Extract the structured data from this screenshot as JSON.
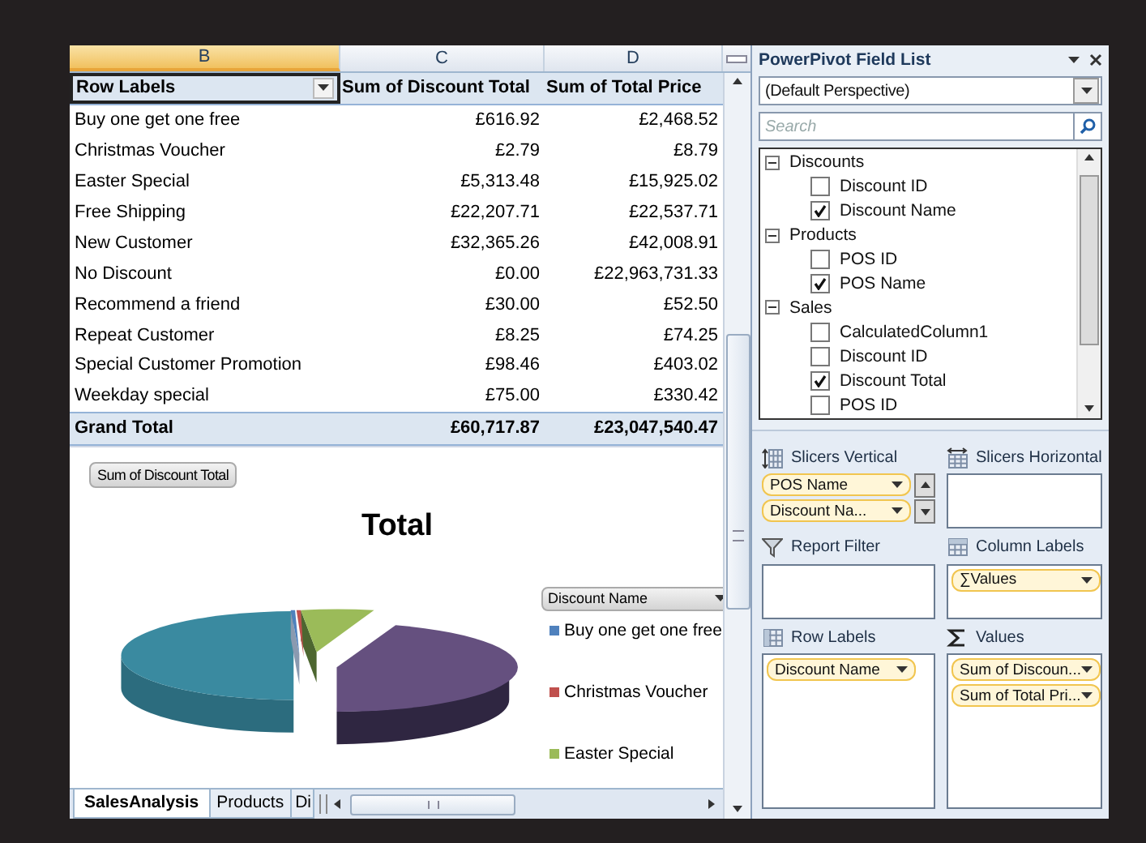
{
  "sheet": {
    "columns": [
      {
        "label": "B",
        "selected": true
      },
      {
        "label": "C",
        "selected": false
      },
      {
        "label": "D",
        "selected": false
      }
    ],
    "pivot": {
      "headers": [
        "Row Labels",
        "Sum of Discount Total",
        "Sum of Total Price"
      ],
      "rows": [
        {
          "label": "Buy one get one free",
          "values": [
            "£616.92",
            "£2,468.52"
          ]
        },
        {
          "label": "Christmas Voucher",
          "values": [
            "£2.79",
            "£8.79"
          ]
        },
        {
          "label": "Easter Special",
          "values": [
            "£5,313.48",
            "£15,925.02"
          ]
        },
        {
          "label": "Free Shipping",
          "values": [
            "£22,207.71",
            "£22,537.71"
          ]
        },
        {
          "label": "New Customer",
          "values": [
            "£32,365.26",
            "£42,008.91"
          ]
        },
        {
          "label": "No Discount",
          "values": [
            "£0.00",
            "£22,963,731.33"
          ]
        },
        {
          "label": "Recommend a friend",
          "values": [
            "£30.00",
            "£52.50"
          ]
        },
        {
          "label": "Repeat Customer",
          "values": [
            "£8.25",
            "£74.25"
          ]
        },
        {
          "label": "Special Customer Promotion",
          "values": [
            "£98.46",
            "£403.02"
          ]
        },
        {
          "label": "Weekday special",
          "values": [
            "£75.00",
            "£330.42"
          ]
        }
      ],
      "grand_total": {
        "label": "Grand Total",
        "values": [
          "£60,717.87",
          "£23,047,540.47"
        ]
      }
    },
    "chart": {
      "field_button": "Sum of Discount Total",
      "title": "Total",
      "legend_button": "Discount Name",
      "legend": [
        {
          "label": "Buy one get one free",
          "color": "#4f81bd"
        },
        {
          "label": "Christmas Voucher",
          "color": "#c0504d"
        },
        {
          "label": "Easter Special",
          "color": "#9bbb59"
        }
      ]
    },
    "tabs": [
      {
        "label": "SalesAnalysis",
        "selected": true
      },
      {
        "label": "Products",
        "selected": false
      },
      {
        "label": "Di",
        "selected": false
      }
    ]
  },
  "field_list": {
    "title": "PowerPivot Field List",
    "perspective": "(Default Perspective)",
    "search": {
      "placeholder": "Search"
    },
    "tables": [
      {
        "name": "Discounts",
        "expanded": true,
        "children": [
          {
            "name": "Discount ID",
            "checked": false
          },
          {
            "name": "Discount Name",
            "checked": true
          }
        ]
      },
      {
        "name": "Products",
        "expanded": true,
        "children": [
          {
            "name": "POS ID",
            "checked": false
          },
          {
            "name": "POS Name",
            "checked": true
          }
        ]
      },
      {
        "name": "Sales",
        "expanded": true,
        "children": [
          {
            "name": "CalculatedColumn1",
            "checked": false
          },
          {
            "name": "Discount ID",
            "checked": false
          },
          {
            "name": "Discount Total",
            "checked": true
          },
          {
            "name": "POS ID",
            "checked": false
          }
        ]
      }
    ],
    "areas": [
      {
        "title": "Slicers Vertical",
        "kind": "slicers-vertical",
        "fields": [
          "POS Name",
          "Discount Na..."
        ]
      },
      {
        "title": "Slicers Horizontal",
        "kind": "slicers-horizontal"
      },
      {
        "title": "Report Filter",
        "kind": "filter"
      },
      {
        "title": "Column Labels",
        "kind": "columns",
        "fields": [
          "∑Values"
        ]
      },
      {
        "title": "Row Labels",
        "kind": "rows",
        "fields": [
          "Discount Name"
        ]
      },
      {
        "title": "Values",
        "kind": "values",
        "fields": [
          "Sum of Discoun...",
          "Sum of Total Pri..."
        ]
      }
    ]
  }
}
